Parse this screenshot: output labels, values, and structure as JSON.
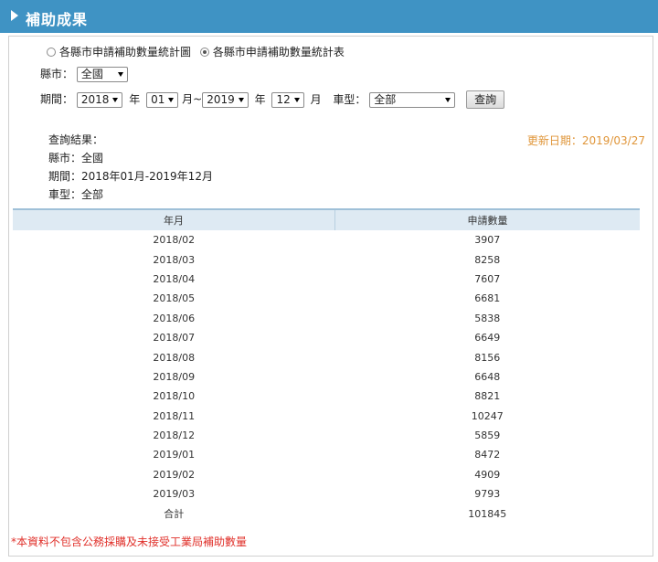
{
  "header": {
    "title": "補助成果"
  },
  "view_options": {
    "chart_label": "各縣市申請補助數量統計圖",
    "table_label": "各縣市申請補助數量統計表",
    "selected": "table"
  },
  "filters": {
    "county_label": "縣市：",
    "county_value": "全國",
    "period_label": "期間：",
    "start_year": "2018",
    "year_unit": "年",
    "start_month": "01",
    "month_tilde": "月~",
    "end_year": "2019",
    "end_month": "12",
    "month_unit": "月",
    "vehicle_label": "車型：",
    "vehicle_value": "全部",
    "query_button": "查詢"
  },
  "result": {
    "heading": "查詢結果：",
    "county_line": "縣市：全國",
    "period_line": "期間：2018年01月-2019年12月",
    "vehicle_line": "車型：全部",
    "update_date": "更新日期：2019/03/27"
  },
  "table": {
    "headers": [
      "年月",
      "申請數量"
    ],
    "rows": [
      [
        "2018/02",
        "3907"
      ],
      [
        "2018/03",
        "8258"
      ],
      [
        "2018/04",
        "7607"
      ],
      [
        "2018/05",
        "6681"
      ],
      [
        "2018/06",
        "5838"
      ],
      [
        "2018/07",
        "6649"
      ],
      [
        "2018/08",
        "8156"
      ],
      [
        "2018/09",
        "6648"
      ],
      [
        "2018/10",
        "8821"
      ],
      [
        "2018/11",
        "10247"
      ],
      [
        "2018/12",
        "5859"
      ],
      [
        "2019/01",
        "8472"
      ],
      [
        "2019/02",
        "4909"
      ],
      [
        "2019/03",
        "9793"
      ]
    ],
    "total_label": "合計",
    "total_value": "101845"
  },
  "footnote": "*本資料不包含公務採購及未接受工業局補助數量"
}
